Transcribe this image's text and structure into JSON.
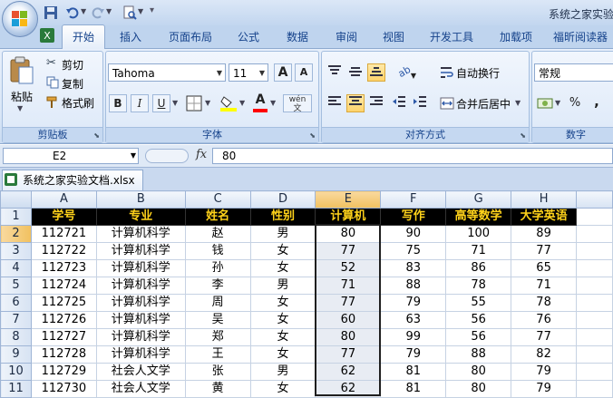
{
  "window": {
    "title": "系统之家实验"
  },
  "tabs": [
    "开始",
    "插入",
    "页面布局",
    "公式",
    "数据",
    "审阅",
    "视图",
    "开发工具",
    "加载项",
    "福昕阅读器"
  ],
  "clipboard": {
    "paste": "粘贴",
    "cut": "剪切",
    "copy": "复制",
    "format_painter": "格式刷",
    "label": "剪贴板"
  },
  "font": {
    "name": "Tahoma",
    "size": "11",
    "grow": "A",
    "shrink": "A",
    "bold": "B",
    "italic": "I",
    "underline": "U",
    "font_color_letter": "A",
    "phonetic": "wén",
    "label": "字体"
  },
  "alignment": {
    "wrap": "自动换行",
    "merge": "合并后居中",
    "label": "对齐方式"
  },
  "number": {
    "format": "常规",
    "percent": "%",
    "comma": ",",
    "label": "数字"
  },
  "formula_bar": {
    "cell_ref": "E2",
    "fx": "fx",
    "content": "80"
  },
  "workbook_tab": "系统之家实验文档.xlsx",
  "sheet": {
    "columns": [
      "A",
      "B",
      "C",
      "D",
      "E",
      "F",
      "G",
      "H"
    ],
    "headers": [
      "学号",
      "专业",
      "姓名",
      "性别",
      "计算机",
      "写作",
      "高等数学",
      "大学英语"
    ],
    "rows": [
      [
        "112721",
        "计算机科学",
        "赵",
        "男",
        "80",
        "90",
        "100",
        "89"
      ],
      [
        "112722",
        "计算机科学",
        "钱",
        "女",
        "77",
        "75",
        "71",
        "77"
      ],
      [
        "112723",
        "计算机科学",
        "孙",
        "女",
        "52",
        "83",
        "86",
        "65"
      ],
      [
        "112724",
        "计算机科学",
        "李",
        "男",
        "71",
        "88",
        "78",
        "71"
      ],
      [
        "112725",
        "计算机科学",
        "周",
        "女",
        "77",
        "79",
        "55",
        "78"
      ],
      [
        "112726",
        "计算机科学",
        "吴",
        "女",
        "60",
        "63",
        "56",
        "76"
      ],
      [
        "112727",
        "计算机科学",
        "郑",
        "女",
        "80",
        "99",
        "56",
        "77"
      ],
      [
        "112728",
        "计算机科学",
        "王",
        "女",
        "77",
        "79",
        "88",
        "82"
      ],
      [
        "112729",
        "社会人文学",
        "张",
        "男",
        "62",
        "81",
        "80",
        "79"
      ],
      [
        "112730",
        "社会人文学",
        "黄",
        "女",
        "62",
        "81",
        "80",
        "79"
      ]
    ]
  }
}
